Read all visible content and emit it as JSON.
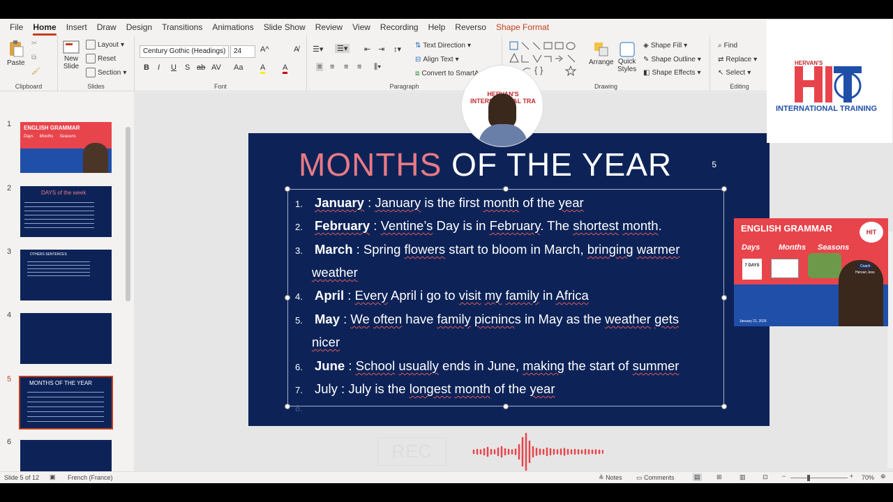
{
  "tabs": [
    "File",
    "Home",
    "Insert",
    "Draw",
    "Design",
    "Transitions",
    "Animations",
    "Slide Show",
    "Review",
    "View",
    "Recording",
    "Help",
    "Reverso",
    "Shape Format"
  ],
  "clipboard": {
    "paste": "Paste",
    "label": "Clipboard"
  },
  "slides_group": {
    "new_slide_line1": "New",
    "new_slide_line2": "Slide",
    "layout": "Layout",
    "reset": "Reset",
    "section": "Section",
    "label": "Slides"
  },
  "font": {
    "family": "Century Gothic (Headings)",
    "size": "24",
    "label": "Font",
    "bold": "B",
    "italic": "I",
    "underline": "U",
    "shadow": "S",
    "strike": "ab",
    "spacing": "AV",
    "case": "Aa",
    "highlight": "A",
    "color": "A"
  },
  "paragraph": {
    "text_direction": "Text Direction",
    "align_text": "Align Text",
    "convert_smart": "Convert to SmartArt",
    "label": "Paragraph"
  },
  "drawing": {
    "arrange": "Arrange",
    "quick_styles_line1": "Quick",
    "quick_styles_line2": "Styles",
    "shape_fill": "Shape Fill",
    "shape_outline": "Shape Outline",
    "shape_effects": "Shape Effects",
    "label": "Drawing"
  },
  "editing": {
    "find": "Find",
    "replace": "Replace",
    "select": "Select",
    "label": "Editing"
  },
  "thumbnails": [
    {
      "num": "1",
      "title": "ENGLISH GRAMMAR",
      "sub1": "Days",
      "sub2": "Months",
      "sub3": "Seasons"
    },
    {
      "num": "2",
      "title": "DAYS of the week"
    },
    {
      "num": "3",
      "title": "OTHERS SENTENCES"
    },
    {
      "num": "4"
    },
    {
      "num": "5",
      "title": "MONTHS OF THE YEAR"
    },
    {
      "num": "6"
    }
  ],
  "slide": {
    "title_accent": "MONTHS",
    "title_rest": " OF THE YEAR",
    "page_number": "5",
    "items": [
      {
        "n": "1.",
        "parts": [
          {
            "t": "January",
            "b": true,
            "u": true
          },
          {
            "t": " :  "
          },
          {
            "t": "January",
            "u": true
          },
          {
            "t": " is the first "
          },
          {
            "t": "month",
            "u": true
          },
          {
            "t": " of the "
          },
          {
            "t": "year",
            "u": true
          }
        ]
      },
      {
        "n": "2.",
        "parts": [
          {
            "t": "February",
            "b": true,
            "u": true
          },
          {
            "t": " : "
          },
          {
            "t": "Ventine’s",
            "u": true
          },
          {
            "t": " Day is in "
          },
          {
            "t": "February",
            "u": true
          },
          {
            "t": ". The "
          },
          {
            "t": "shortest",
            "u": true
          },
          {
            "t": " "
          },
          {
            "t": "month",
            "u": true
          },
          {
            "t": "."
          }
        ]
      },
      {
        "n": "3.",
        "parts": [
          {
            "t": "March",
            "b": true
          },
          {
            "t": " : Spring "
          },
          {
            "t": "flowers",
            "u": true
          },
          {
            "t": " start to bloom in March, "
          },
          {
            "t": "bringing",
            "u": true
          },
          {
            "t": " "
          },
          {
            "t": "warmer",
            "u": true
          }
        ]
      },
      {
        "n": "",
        "parts": [
          {
            "t": "weather",
            "u": true
          }
        ]
      },
      {
        "n": "4.",
        "parts": [
          {
            "t": "April",
            "b": true
          },
          {
            "t": " : "
          },
          {
            "t": "Every",
            "u": true
          },
          {
            "t": " April i go to "
          },
          {
            "t": "visit",
            "u": true
          },
          {
            "t": " "
          },
          {
            "t": "my",
            "u": true
          },
          {
            "t": " "
          },
          {
            "t": "family",
            "u": true
          },
          {
            "t": " in "
          },
          {
            "t": "Africa",
            "u": true
          }
        ]
      },
      {
        "n": "5.",
        "parts": [
          {
            "t": "May",
            "b": true
          },
          {
            "t": " : "
          },
          {
            "t": "We",
            "u": true
          },
          {
            "t": " "
          },
          {
            "t": "often",
            "u": true
          },
          {
            "t": " have "
          },
          {
            "t": "family",
            "u": true
          },
          {
            "t": " "
          },
          {
            "t": "picninc",
            "u": true
          },
          {
            "t": "s in May as the "
          },
          {
            "t": "weather",
            "u": true
          },
          {
            "t": " "
          },
          {
            "t": "gets",
            "u": true
          }
        ]
      },
      {
        "n": "",
        "parts": [
          {
            "t": "nicer",
            "u": true
          }
        ]
      },
      {
        "n": "6.",
        "parts": [
          {
            "t": "June",
            "b": true
          },
          {
            "t": " : "
          },
          {
            "t": "School",
            "u": true
          },
          {
            "t": " "
          },
          {
            "t": "usually",
            "u": true
          },
          {
            "t": " ends in June, "
          },
          {
            "t": "making",
            "u": true
          },
          {
            "t": " the start of "
          },
          {
            "t": "summer",
            "u": true
          }
        ]
      },
      {
        "n": "7.",
        "parts": [
          {
            "t": "July : July is the "
          },
          {
            "t": "longest",
            "u": true
          },
          {
            "t": " "
          },
          {
            "t": "month",
            "u": true
          },
          {
            "t": " of the "
          },
          {
            "t": "year",
            "u": true
          }
        ]
      },
      {
        "n": "8.",
        "parts": []
      }
    ]
  },
  "overlay": {
    "rec": "REC",
    "logo_top": "HERVAN'S",
    "logo_sub": "INTERNATIONAL TRAINING",
    "webcam_text": "HERVAN'S INTERNATIONAL TRA",
    "pip_title": "ENGLISH GRAMMAR",
    "pip_days": "Days",
    "pip_months": "Months",
    "pip_seasons": "Seasons",
    "pip_coach": "Coach",
    "pip_name": "Hervan Jess",
    "pip_date": "January 21, 2026",
    "pip_logo": "HIT",
    "pip_days_box": "7 DAYS"
  },
  "status": {
    "slide_of": "Slide 5 of 12",
    "language": "French (France)",
    "notes": "Notes",
    "comments": "Comments",
    "zoom": "70%"
  },
  "colors": {
    "accent": "#c43e1c",
    "slide_bg": "#0d2358",
    "title_accent": "#e97a85",
    "brand_red": "#e8444b",
    "brand_blue": "#1f4fa8"
  }
}
